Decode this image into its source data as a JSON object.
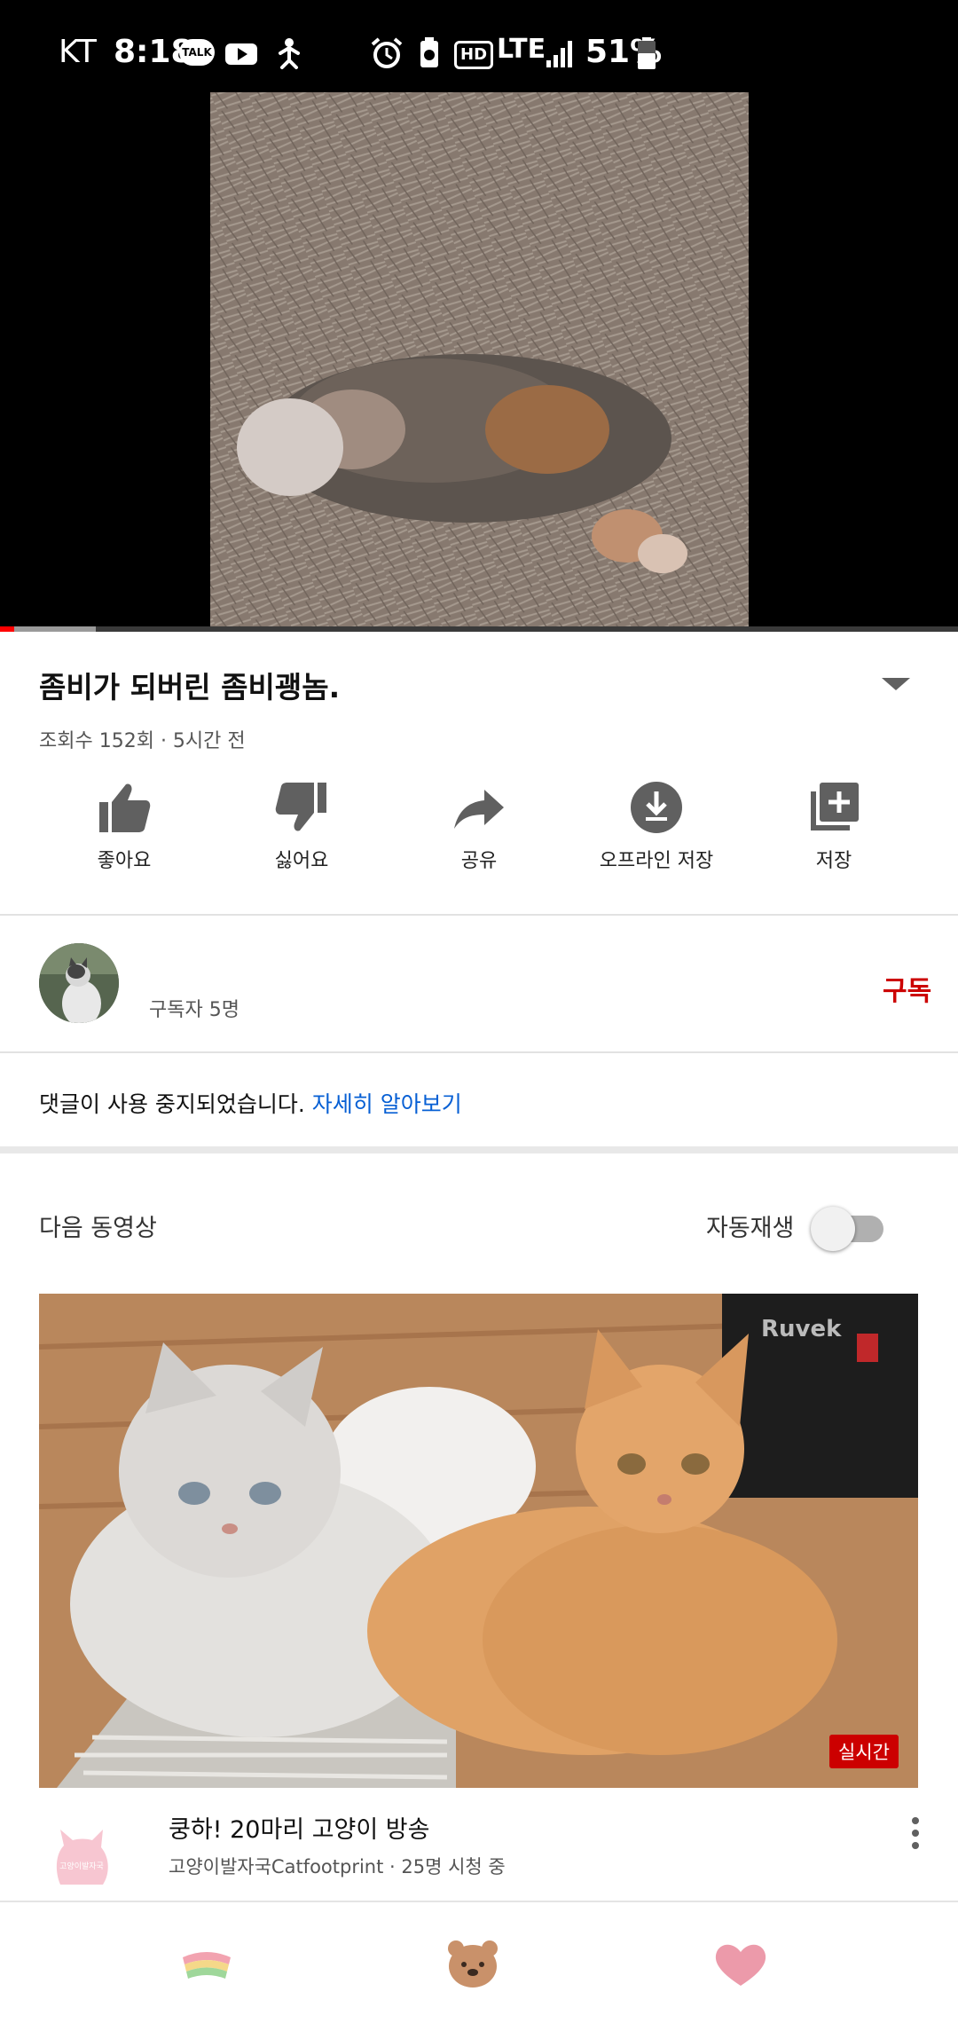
{
  "status_bar": {
    "carrier": "KT",
    "time": "8:18",
    "kakao_badge": "TALK",
    "network": "LTE",
    "hd_badge": "HD",
    "battery": "51%"
  },
  "video": {
    "progress_played": 0.015,
    "progress_buffered": 0.1
  },
  "info": {
    "title": "좀비가 되버린 좀비괭놈.",
    "meta": "조회수 152회 · 5시간 전"
  },
  "actions": [
    {
      "label": "좋아요",
      "icon": "thumb-up-icon"
    },
    {
      "label": "싫어요",
      "icon": "thumb-down-icon"
    },
    {
      "label": "공유",
      "icon": "share-icon"
    },
    {
      "label": "오프라인 저장",
      "icon": "download-icon"
    },
    {
      "label": "저장",
      "icon": "playlist-add-icon"
    }
  ],
  "channel": {
    "subscribers": "구독자 5명",
    "subscribe_label": "구독"
  },
  "comments": {
    "text": "댓글이 사용 중지되었습니다.",
    "link": "자세히 알아보기"
  },
  "up_next": {
    "label": "다음 동영상",
    "autoplay_label": "자동재생",
    "autoplay_on": false
  },
  "next_video": {
    "live_badge": "실시간",
    "thumb_brand": "Ruvek",
    "channel_logo_text": "고양이발자국",
    "title": "쿵하! 20마리 고양이 방송",
    "subtitle": "고양이발자국Catfootprint · 25명 시청 중"
  },
  "bottom_nav": [
    {
      "icon": "rainbow-icon"
    },
    {
      "icon": "bear-icon"
    },
    {
      "icon": "heart-icon"
    }
  ],
  "colors": {
    "accent_red": "#cc0000",
    "link_blue": "#065fd4",
    "progress_red": "#ff0000"
  }
}
